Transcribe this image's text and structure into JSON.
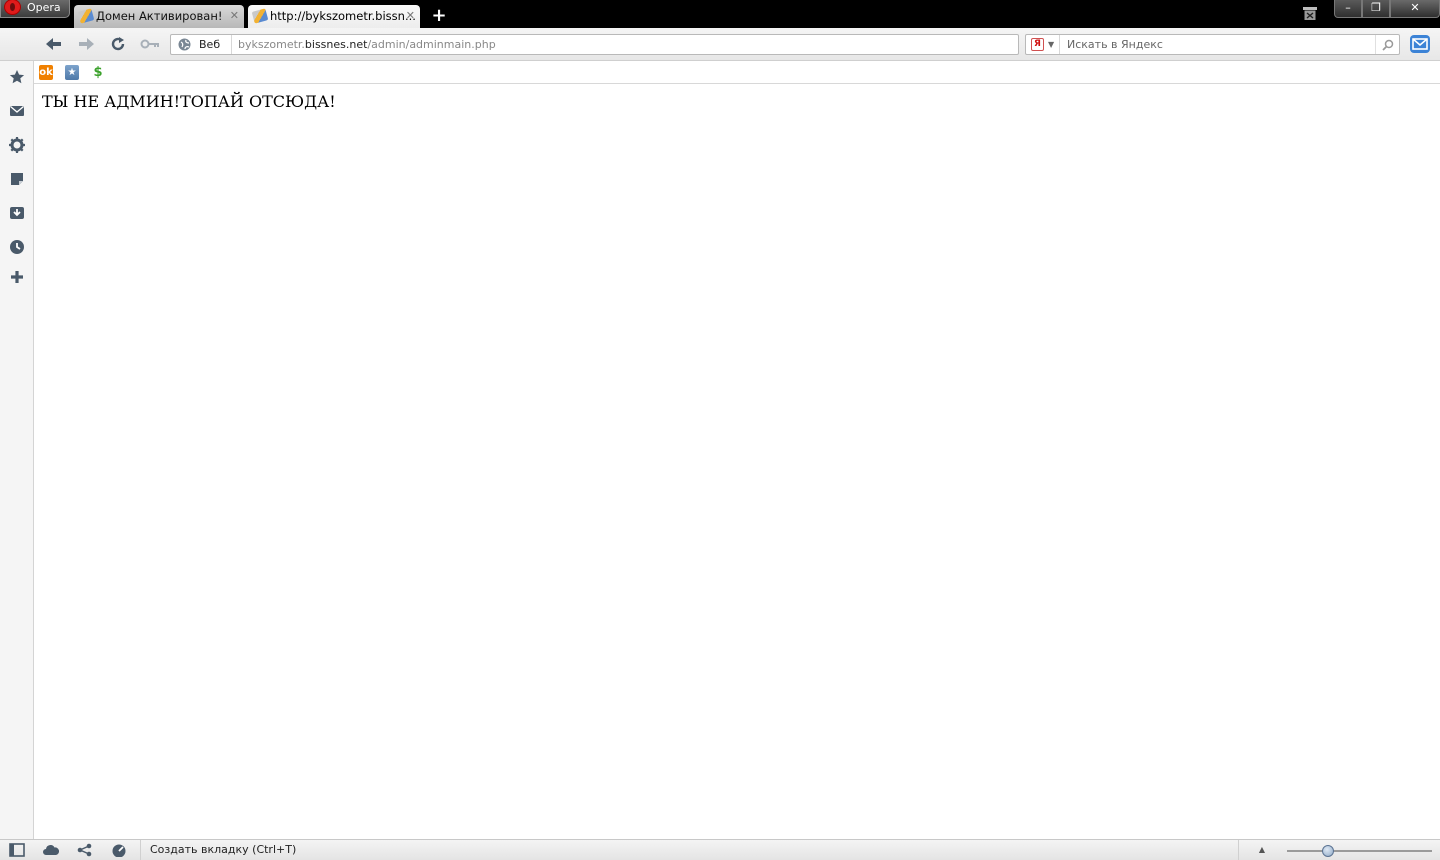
{
  "browser": {
    "menu_label": "Opera",
    "tabs": [
      {
        "title": "Домен Активирован!",
        "close": "✕",
        "active": false
      },
      {
        "title": "http://bykszometr.bissn...",
        "close": "✕",
        "active": true
      }
    ],
    "new_tab_symbol": "+",
    "window_controls": {
      "minimize": "–",
      "maximize": "❐",
      "close": "✕"
    }
  },
  "toolbar": {
    "security_badge": "Веб",
    "url": {
      "prefix": "bykszometr.",
      "domain": "bissnes.net",
      "path": "/admin/adminmain.php"
    },
    "search": {
      "engine_icon": "Я",
      "placeholder": "Искать в Яндекс",
      "value": ""
    }
  },
  "bookmarks": [
    {
      "name": "odnoklassniki-icon",
      "glyph": "ok"
    },
    {
      "name": "favorites-star-icon",
      "glyph": "★"
    },
    {
      "name": "money-icon",
      "glyph": "$"
    }
  ],
  "sidepanel": {
    "icons": [
      "star-icon",
      "mail-icon",
      "gear-icon",
      "notes-icon",
      "downloads-icon",
      "history-icon",
      "add-panel-icon"
    ]
  },
  "page": {
    "message": "ТЫ НЕ АДМИН!ТОПАЙ ОТСЮДА!"
  },
  "statusbar": {
    "hint": "Создать вкладку (Ctrl+T)",
    "zoom_level": 0.28
  },
  "colors": {
    "accent": "#3c83d6",
    "titlebar": "#000000",
    "icon": "#4a5a6a"
  }
}
